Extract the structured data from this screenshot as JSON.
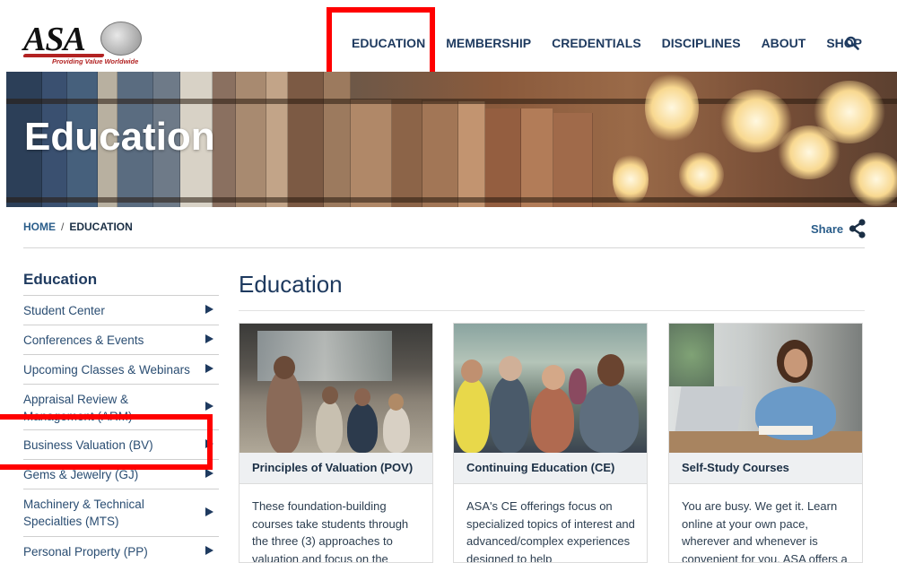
{
  "brand": {
    "logo_text": "ASA",
    "tagline": "Providing Value Worldwide"
  },
  "nav": {
    "items": [
      "EDUCATION",
      "MEMBERSHIP",
      "CREDENTIALS",
      "DISCIPLINES",
      "ABOUT",
      "SHOP"
    ],
    "search_icon": "search-icon"
  },
  "hero": {
    "title": "Education"
  },
  "breadcrumb": {
    "home": "HOME",
    "separator": "/",
    "current": "EDUCATION"
  },
  "share": {
    "label": "Share",
    "icon": "share-icon"
  },
  "sidebar": {
    "title": "Education",
    "items": [
      "Student Center",
      "Conferences & Events",
      "Upcoming Classes & Webinars",
      "Appraisal Review & Management (ARM)",
      "Business Valuation (BV)",
      "Gems & Jewelry (GJ)",
      "Machinery & Technical Specialties (MTS)",
      "Personal Property (PP)"
    ]
  },
  "main": {
    "title": "Education",
    "cards": [
      {
        "title": "Principles of Valuation (POV)",
        "text": "These foundation-building courses take students through the three (3) approaches to valuation and focus on the"
      },
      {
        "title": "Continuing Education (CE)",
        "text": "ASA's CE offerings focus on specialized topics of interest and advanced/complex experiences designed to help"
      },
      {
        "title": "Self-Study Courses",
        "text": "You are busy. We get it. Learn online at your own pace, wherever and whenever is convenient for you. ASA offers a"
      }
    ]
  },
  "colors": {
    "navy": "#1e3a5f",
    "link_blue": "#2a5d8a",
    "highlight_red": "#ff0000",
    "card_header_bg": "#eef0f2"
  }
}
